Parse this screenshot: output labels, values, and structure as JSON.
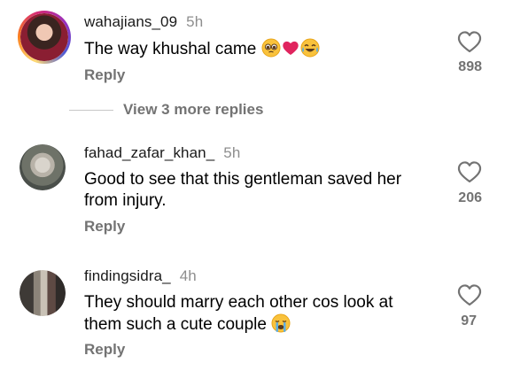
{
  "comments": [
    {
      "username": "wahajians_09",
      "time": "5h",
      "text": "The way khushal came",
      "reply_label": "Reply",
      "likes": "898",
      "emojis": [
        "pleading-face-emoji",
        "red-heart-emoji",
        "tears-of-joy-emoji"
      ]
    },
    {
      "username": "fahad_zafar_khan_",
      "time": "5h",
      "text_line1": "Good to see that this gentleman saved her",
      "text_line2": "from injury.",
      "reply_label": "Reply",
      "likes": "206"
    },
    {
      "username": "findingsidra_",
      "time": "4h",
      "text_line1": "They should marry each other cos look at",
      "text_line2": "them such a cute couple",
      "reply_label": "Reply",
      "likes": "97",
      "emojis": [
        "loudly-crying-face-emoji"
      ]
    }
  ],
  "view_more_replies": "View 3 more replies",
  "colors": {
    "secondary_text": "#737373",
    "divider": "#c7c7c7",
    "heart_emoji": "#e0245e"
  }
}
